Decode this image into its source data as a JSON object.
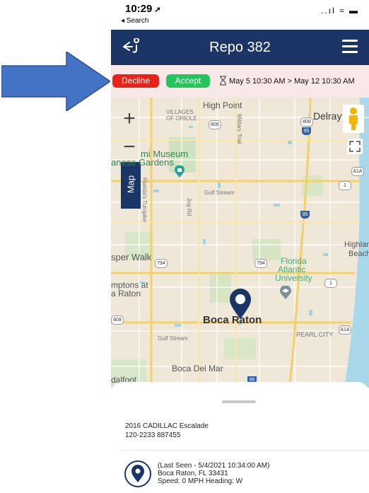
{
  "status_bar": {
    "time": "10:29",
    "back_app": "◂ Search",
    "signal_wifi_battery": "..ıl ≈ ▬"
  },
  "header": {
    "title": "Repo 382"
  },
  "action_bar": {
    "decline_label": "Decline",
    "accept_label": "Accept",
    "schedule": "May 5 10:30 AM > May 12 10:30 AM"
  },
  "map": {
    "tab_label": "Map",
    "zoom_in": "+",
    "zoom_out": "−",
    "labels": {
      "high_point": "High Point",
      "villages_of_oriole_1": "VILLAGES",
      "villages_of_oriole_2": "OF ORIOLE",
      "delray": "Delray",
      "museum_1": "mi Museum",
      "museum_2": "anese Gardens",
      "gulf_stream": "Gulf Stream",
      "jog_rd": "Jog Rd",
      "military_trail": "Military Trail",
      "florida_turnpike": "Florida's Turnpike",
      "highland_beach_1": "Highland",
      "highland_beach_2": "Beach",
      "sper_walk": "sper Walk",
      "florida_atlantic_1": "Florida",
      "florida_atlantic_2": "Atlantic",
      "florida_atlantic_3": "University",
      "mptons_1": "mptons at",
      "mptons_2": "a Raton",
      "boca_raton": "Boca Raton",
      "pearl_city": "PEARL CITY",
      "gulf_stream_2": "Gulf Stream",
      "boca_del_mar": "Boca Del Mar",
      "dalfoot": "dalfoot",
      "shield_806a": "806",
      "shield_806b": "806",
      "shield_794a": "794",
      "shield_794b": "794",
      "shield_a1a_1": "A1A",
      "shield_a1a_2": "A1A",
      "shield_1a": "1",
      "shield_1b": "1",
      "shield_808": "808",
      "i95_a": "95",
      "i95_b": "95",
      "i95_c": "95"
    }
  },
  "vehicle": {
    "name": "2016 CADILLAC Escalade",
    "plate": "120-2233 887455"
  },
  "location": {
    "last_seen": "(Last Seen - 5/4/2021 10:34:00 AM)",
    "address": "Boca Raton, FL 33431",
    "speed_heading": "Speed: 0 MPH  Heading: W"
  },
  "colors": {
    "navbar": "#1a3566",
    "decline": "#e8231a",
    "accept": "#23c65a",
    "arrow": "#4472c4",
    "pin": "#1a3566"
  }
}
